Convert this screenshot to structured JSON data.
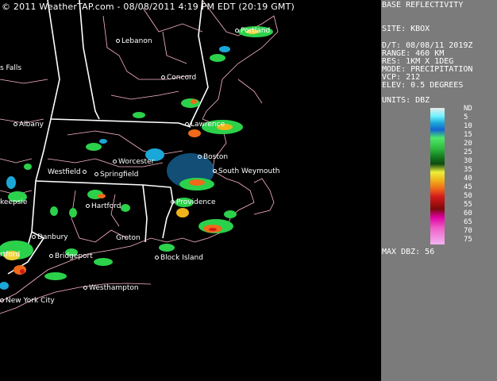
{
  "banner": "© 2011 WeatherTAP.com - 08/08/2011  4:19 PM EDT (20:19 GMT)",
  "cities": [
    {
      "name": "Portland",
      "label": "Portland"
    },
    {
      "name": "Lebanon",
      "label": "Lebanon"
    },
    {
      "name": "Falls",
      "label": "s Falls"
    },
    {
      "name": "Concord",
      "label": "Concord"
    },
    {
      "name": "Albany",
      "label": "Albany"
    },
    {
      "name": "Lawrence",
      "label": "Lawrence"
    },
    {
      "name": "Boston",
      "label": "Boston"
    },
    {
      "name": "Worcester",
      "label": "Worcester"
    },
    {
      "name": "Westfield",
      "label": "Westfield"
    },
    {
      "name": "Springfield",
      "label": "Springfield"
    },
    {
      "name": "South Weymouth",
      "label": "South Weymouth"
    },
    {
      "name": "Poughkeepsie",
      "label": "keepsie"
    },
    {
      "name": "Hartford",
      "label": "Hartford"
    },
    {
      "name": "Providence",
      "label": "Providence"
    },
    {
      "name": "Danbury",
      "label": "Danbury"
    },
    {
      "name": "Groton",
      "label": "Groton"
    },
    {
      "name": "Hartford2",
      "label": "rtford"
    },
    {
      "name": "Bridgeport",
      "label": "Bridgeport"
    },
    {
      "name": "Block Island",
      "label": "Block Island"
    },
    {
      "name": "Westhampton",
      "label": "Westhampton"
    },
    {
      "name": "New York City",
      "label": "New York City"
    }
  ],
  "panel": {
    "title": "BASE REFLECTIVITY",
    "site": "SITE:  KBOX",
    "dt": "D/T:    08/08/11 2019Z",
    "range": "RANGE: 460 KM",
    "res": "RES:   1KM X 1DEG",
    "mode": "MODE:  PRECIPITATION",
    "vcp": "VCP:   212",
    "elev": "ELEV:  0.5 DEGREES",
    "units": "UNITS: DBZ",
    "legend": [
      "ND",
      "5",
      "10",
      "15",
      "20",
      "25",
      "30",
      "35",
      "40",
      "45",
      "50",
      "55",
      "60",
      "65",
      "70",
      "75"
    ],
    "max": "MAX DBZ:  56"
  }
}
